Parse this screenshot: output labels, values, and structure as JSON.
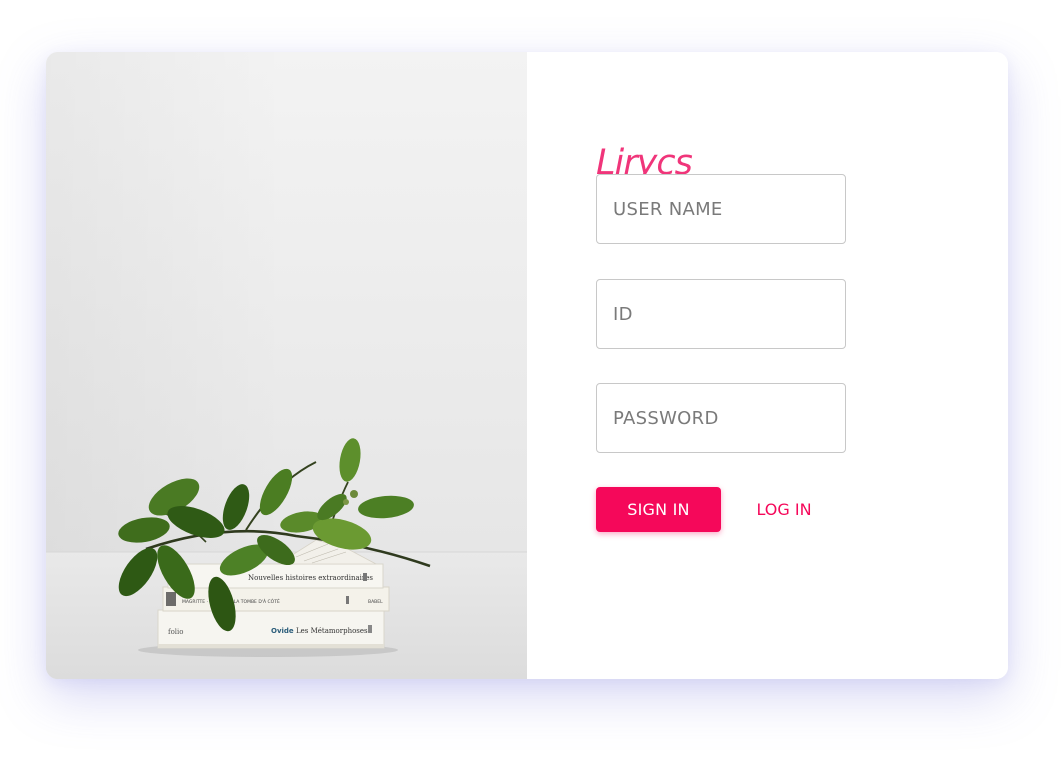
{
  "brand": {
    "name": "Lirycs",
    "color": "#f0357a"
  },
  "form": {
    "username_placeholder": "USER NAME",
    "id_placeholder": "ID",
    "password_placeholder": "PASSWORD",
    "signin_label": "SIGN IN",
    "login_label": "LOG IN"
  },
  "photo": {
    "books": [
      {
        "title": "Nouvelles histoires extraordinaires"
      },
      {
        "title": "MAGRITTE · LE MIC DE LA TOMBE D'À CÔTÉ",
        "spine_right": "BABEL"
      },
      {
        "publisher": "folio",
        "author": "Ovide",
        "title": "Les Métamorphoses"
      }
    ]
  },
  "colors": {
    "accent": "#f5085a",
    "card_shadow": "#7878dc",
    "leaf": "#3e6b1f"
  }
}
